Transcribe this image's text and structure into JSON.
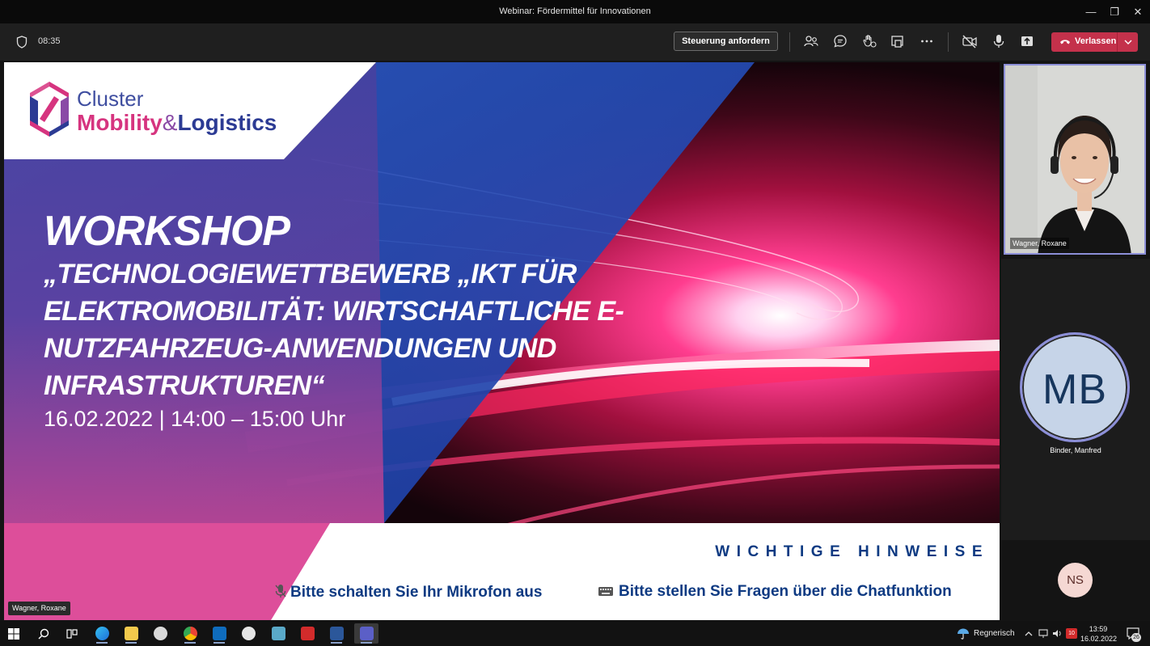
{
  "window": {
    "title": "Webinar: Fördermittel für Innovationen",
    "minimize": "—",
    "restore": "❐",
    "close": "✕"
  },
  "meeting_bar": {
    "elapsed_time": "08:35",
    "request_control_label": "Steuerung anfordern",
    "leave_label": "Verlassen",
    "icons": [
      "people-icon",
      "chat-icon",
      "reactions-icon",
      "share-tray-icon",
      "more-icon",
      "camera-off-icon",
      "microphone-icon",
      "share-icon"
    ]
  },
  "slide": {
    "logo_cluster": "Cluster",
    "logo_mobility": "Mobility",
    "logo_amp": "&",
    "logo_logistics": "Logistics",
    "heading": "WORKSHOP",
    "subtitle_line1": "„TECHNOLOGIEWETTBEWERB „IKT FÜR",
    "subtitle_line2": "ELEKTROMOBILITÄT: WIRTSCHAFTLICHE E-",
    "subtitle_line3": "NUTZFAHRZEUG-ANWENDUNGEN UND",
    "subtitle_line4": "INFRASTRUKTUREN“",
    "date_time": "16.02.2022 | 14:00 – 15:00 Uhr",
    "notes_heading": "WICHTIGE HINWEISE",
    "note_mic": "Bitte schalten Sie Ihr Mikrofon aus",
    "note_chat": "Bitte stellen Sie Fragen über die Chatfunktion",
    "presenter_name": "Wagner, Roxane",
    "colors": {
      "navy": "#0e3a82",
      "magenta": "#d6347f",
      "purple": "#5b3a96"
    }
  },
  "participants": {
    "video_name": "Wagner, Roxane",
    "mb_initials": "MB",
    "mb_name": "Binder, Manfred",
    "ns_initials": "NS"
  },
  "taskbar": {
    "apps": [
      "windows-logo",
      "search",
      "task-view",
      "edge",
      "file-explorer",
      "paint",
      "chrome",
      "outlook",
      "app-cloud",
      "app-notes",
      "app-red",
      "word",
      "teams"
    ],
    "weather": "Regnerisch",
    "time": "13:59",
    "date": "16.02.2022",
    "notification_count": "26",
    "badge": "10"
  }
}
